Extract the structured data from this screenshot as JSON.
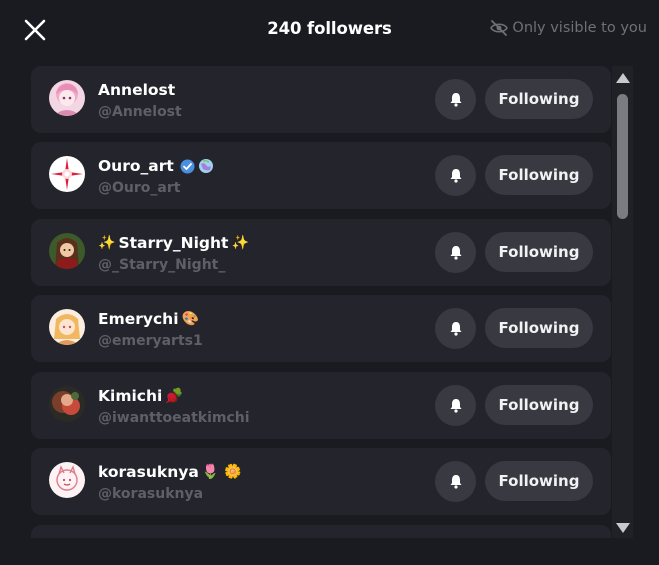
{
  "header": {
    "close_icon": "close-icon",
    "title": "240 followers",
    "visibility_icon": "eye-slash-icon",
    "visibility_text": "Only visible to you"
  },
  "followers": [
    {
      "name": "Annelost",
      "handle": "@Annelost",
      "badges": [],
      "prefix": "",
      "suffix": "",
      "button_label": "Following",
      "avatar_icon": "anime-avatar-pink"
    },
    {
      "name": "Ouro_art",
      "handle": "@Ouro_art",
      "badges": [
        "verified-icon",
        "globe-emoji-icon"
      ],
      "prefix": "",
      "suffix": "",
      "button_label": "Following",
      "avatar_icon": "star-sparkle-avatar"
    },
    {
      "name": "Starry_Night",
      "handle": "@_Starry_Night_",
      "badges": [],
      "prefix": "✨",
      "suffix": "✨",
      "button_label": "Following",
      "avatar_icon": "anime-avatar-dark"
    },
    {
      "name": "Emerychi",
      "handle": "@emeryarts1",
      "badges": [
        "palette-emoji-icon"
      ],
      "prefix": "",
      "suffix": "🎨",
      "button_label": "Following",
      "avatar_icon": "anime-avatar-blonde"
    },
    {
      "name": "Kimichi",
      "handle": "@iwanttoeatkimchi",
      "badges": [
        "radish-emoji-icon"
      ],
      "prefix": "",
      "suffix": "🫜",
      "button_label": "Following",
      "avatar_icon": "blurred-avatar-red"
    },
    {
      "name": "korasuknya",
      "handle": "@korasuknya",
      "badges": [
        "tulip-emoji-icon",
        "flower-emoji-icon"
      ],
      "prefix": "",
      "suffix": "🌷 🌼",
      "button_label": "Following",
      "avatar_icon": "sketch-avatar-pink"
    }
  ],
  "colors": {
    "background": "#1a1b21",
    "row": "#24252c",
    "button": "#383941",
    "muted_text": "#5e5f67",
    "verified": "#4a90e2"
  }
}
